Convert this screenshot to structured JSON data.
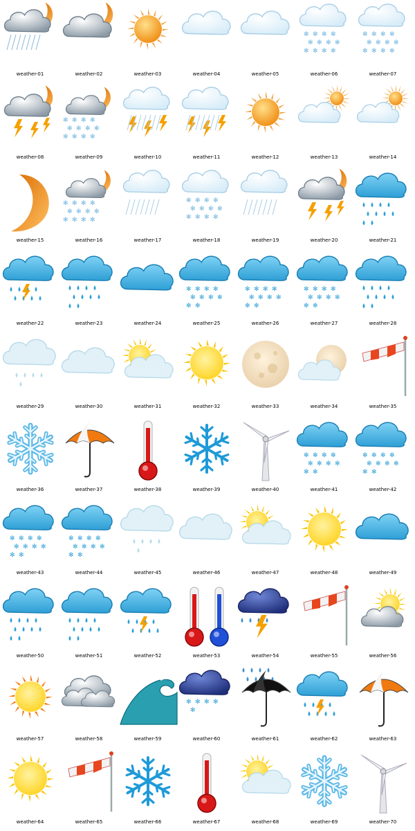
{
  "icons": [
    {
      "label": "weather-01",
      "icon": "storm-cloud-moon-icon",
      "kind": "cloudmoonstorm"
    },
    {
      "label": "weather-02",
      "icon": "cloud-moon-icon",
      "kind": "cloudmoon"
    },
    {
      "label": "weather-03",
      "icon": "sun-icon",
      "kind": "sunorange"
    },
    {
      "label": "weather-04",
      "icon": "cloud-icon",
      "kind": "cloudpale"
    },
    {
      "label": "weather-05",
      "icon": "cloud-icon",
      "kind": "cloudpale"
    },
    {
      "label": "weather-06",
      "icon": "snow-cloud-icon",
      "kind": "cloudsnow"
    },
    {
      "label": "weather-07",
      "icon": "snow-cloud-icon",
      "kind": "cloudsnow"
    },
    {
      "label": "weather-08",
      "icon": "thunderstorm-moon-icon",
      "kind": "cloudmoonbolt"
    },
    {
      "label": "weather-09",
      "icon": "snow-moon-icon",
      "kind": "cloudmoonsnow"
    },
    {
      "label": "weather-10",
      "icon": "thunderstorm-icon",
      "kind": "cloudbolt"
    },
    {
      "label": "weather-11",
      "icon": "thunderstorm-icon",
      "kind": "cloudbolt"
    },
    {
      "label": "weather-12",
      "icon": "sun-icon",
      "kind": "sunorange"
    },
    {
      "label": "weather-13",
      "icon": "partly-sunny-cloud-icon",
      "kind": "cloudsunsmall"
    },
    {
      "label": "weather-14",
      "icon": "partly-sunny-cloud-icon",
      "kind": "cloudsunsmall"
    },
    {
      "label": "weather-15",
      "icon": "crescent-moon-icon",
      "kind": "moon"
    },
    {
      "label": "weather-16",
      "icon": "snow-moon-icon",
      "kind": "cloudmoonsnow"
    },
    {
      "label": "weather-17",
      "icon": "rain-cloud-icon",
      "kind": "cloudrain"
    },
    {
      "label": "weather-18",
      "icon": "snow-cloud-icon",
      "kind": "cloudsnow"
    },
    {
      "label": "weather-19",
      "icon": "rain-cloud-icon",
      "kind": "cloudrain"
    },
    {
      "label": "weather-20",
      "icon": "thunderstorm-moon-icon",
      "kind": "cloudmoonbolt"
    },
    {
      "label": "weather-21",
      "icon": "blue-rain-cloud-icon",
      "kind": "bluerain"
    },
    {
      "label": "weather-22",
      "icon": "blue-storm-cloud-icon",
      "kind": "bluebolt"
    },
    {
      "label": "weather-23",
      "icon": "blue-rain-cloud-icon",
      "kind": "bluerain"
    },
    {
      "label": "weather-24",
      "icon": "blue-cloud-icon",
      "kind": "bluecloud"
    },
    {
      "label": "weather-25",
      "icon": "blue-snow-cloud-icon",
      "kind": "bluesnow"
    },
    {
      "label": "weather-26",
      "icon": "blue-snow-cloud-icon",
      "kind": "bluesnow"
    },
    {
      "label": "weather-27",
      "icon": "blue-sleet-cloud-icon",
      "kind": "bluesnow"
    },
    {
      "label": "weather-28",
      "icon": "blue-rain-cloud-icon",
      "kind": "bluerain"
    },
    {
      "label": "weather-29",
      "icon": "light-rain-cloud-icon",
      "kind": "palerain"
    },
    {
      "label": "weather-30",
      "icon": "pale-cloud-icon",
      "kind": "palecloud"
    },
    {
      "label": "weather-31",
      "icon": "sun-behind-cloud-icon",
      "kind": "sunpale"
    },
    {
      "label": "weather-32",
      "icon": "sun-icon",
      "kind": "sunyellow"
    },
    {
      "label": "weather-33",
      "icon": "full-moon-icon",
      "kind": "fullmoon"
    },
    {
      "label": "weather-34",
      "icon": "moon-behind-cloud-icon",
      "kind": "mooncloud"
    },
    {
      "label": "weather-35",
      "icon": "windsock-icon",
      "kind": "windsock"
    },
    {
      "label": "weather-36",
      "icon": "snowflake-icon",
      "kind": "flake"
    },
    {
      "label": "weather-37",
      "icon": "umbrella-icon",
      "kind": "umbrella"
    },
    {
      "label": "weather-38",
      "icon": "thermometer-hot-icon",
      "kind": "thermored"
    },
    {
      "label": "weather-39",
      "icon": "snowflake-icon",
      "kind": "flakeline"
    },
    {
      "label": "weather-40",
      "icon": "wind-turbine-icon",
      "kind": "turbine"
    },
    {
      "label": "weather-41",
      "icon": "blue-snow-cloud-icon",
      "kind": "bluesnow"
    },
    {
      "label": "weather-42",
      "icon": "blue-snow-cloud-icon",
      "kind": "bluesnow"
    },
    {
      "label": "weather-43",
      "icon": "blue-sleet-cloud-icon",
      "kind": "bluesnow"
    },
    {
      "label": "weather-44",
      "icon": "blue-sleet-cloud-icon",
      "kind": "bluesnow"
    },
    {
      "label": "weather-45",
      "icon": "light-rain-cloud-icon",
      "kind": "palerain"
    },
    {
      "label": "weather-46",
      "icon": "pale-cloud-icon",
      "kind": "palecloud"
    },
    {
      "label": "weather-47",
      "icon": "sun-behind-cloud-icon",
      "kind": "sunpale"
    },
    {
      "label": "weather-48",
      "icon": "sun-icon",
      "kind": "sunyellow"
    },
    {
      "label": "weather-49",
      "icon": "blue-cloud-icon",
      "kind": "bluecloud"
    },
    {
      "label": "weather-50",
      "icon": "blue-rain-cloud-icon",
      "kind": "bluerain"
    },
    {
      "label": "weather-51",
      "icon": "blue-rain-cloud-icon",
      "kind": "bluerain"
    },
    {
      "label": "weather-52",
      "icon": "blue-storm-cloud-icon",
      "kind": "bluebolt"
    },
    {
      "label": "weather-53",
      "icon": "thermometers-icon",
      "kind": "thermopair"
    },
    {
      "label": "weather-54",
      "icon": "dark-storm-cloud-icon",
      "kind": "darkbolt"
    },
    {
      "label": "weather-55",
      "icon": "windsock-icon",
      "kind": "windsock"
    },
    {
      "label": "weather-56",
      "icon": "sun-behind-grey-cloud-icon",
      "kind": "sungrey"
    },
    {
      "label": "weather-57",
      "icon": "sun-icon",
      "kind": "sunpalewhite"
    },
    {
      "label": "weather-58",
      "icon": "grey-clouds-icon",
      "kind": "greyclouds"
    },
    {
      "label": "weather-59",
      "icon": "ocean-wave-icon",
      "kind": "wave"
    },
    {
      "label": "weather-60",
      "icon": "dark-snow-cloud-icon",
      "kind": "darksnow"
    },
    {
      "label": "weather-61",
      "icon": "umbrella-rain-icon",
      "kind": "blackumbrella"
    },
    {
      "label": "weather-62",
      "icon": "blue-storm-cloud-icon",
      "kind": "bluebolt"
    },
    {
      "label": "weather-63",
      "icon": "umbrella-icon",
      "kind": "umbrella"
    },
    {
      "label": "weather-64",
      "icon": "sun-icon",
      "kind": "sunyellow"
    },
    {
      "label": "weather-65",
      "icon": "windsock-icon",
      "kind": "windsock"
    },
    {
      "label": "weather-66",
      "icon": "snowflake-icon",
      "kind": "flakeline"
    },
    {
      "label": "weather-67",
      "icon": "thermometer-hot-icon",
      "kind": "thermored"
    },
    {
      "label": "weather-68",
      "icon": "sun-behind-cloud-icon",
      "kind": "sunpale"
    },
    {
      "label": "weather-69",
      "icon": "snowflake-icon",
      "kind": "flake"
    },
    {
      "label": "weather-70",
      "icon": "wind-turbine-icon",
      "kind": "turbine"
    }
  ],
  "colors": {
    "cloud_pale": "#d6ecf8",
    "cloud_blue": "#2e9fd6",
    "sun_orange": "#f08a10",
    "sun_yellow": "#ffd21e",
    "bolt": "#f5a000",
    "label": "#000000"
  }
}
